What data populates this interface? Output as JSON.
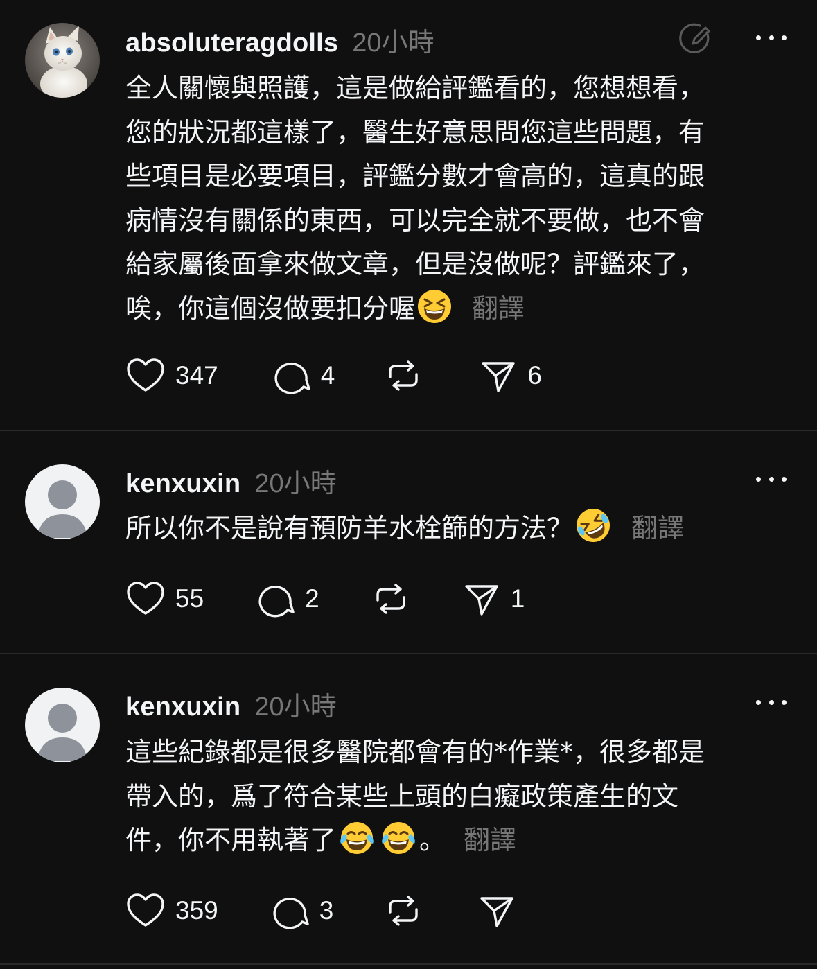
{
  "icons": {
    "like": "heart-icon",
    "reply": "comment-bubble-icon",
    "repost": "repost-icon",
    "share": "send-icon",
    "more": "more-dots-icon",
    "edit": "edit-reply-icon"
  },
  "colors": {
    "background": "#101010",
    "text_primary": "#f3f5f7",
    "text_secondary": "#777777",
    "divider": "#2a2a2a"
  },
  "posts": [
    {
      "username": "absoluteragdolls",
      "time": "20小時",
      "avatar": "cat-avatar",
      "lines": [
        "全人關懷與照護，這是做給評鑑看的，您想想看，",
        "您的狀況都這樣了，醫生好意思問您這些問題，有",
        "些項目是必要項目，評鑑分數才會高的，這真的跟",
        "病情沒有關係的東西，可以完全就不要做，也不會",
        "給家屬後面拿來做文章，但是沒做呢？評鑑來了，",
        "唉，你這個沒做要扣分喔"
      ],
      "emoji": [
        "grinning-squinting-face"
      ],
      "translate": "翻譯",
      "likes": "347",
      "replies": "4",
      "reposts": "",
      "shares": "6"
    },
    {
      "username": "kenxuxin",
      "time": "20小時",
      "avatar": "default-avatar",
      "lines": [
        "所以你不是說有預防羊水栓篩的方法？"
      ],
      "emoji": [
        "rolling-on-the-floor-laughing"
      ],
      "translate": "翻譯",
      "likes": "55",
      "replies": "2",
      "reposts": "",
      "shares": "1"
    },
    {
      "username": "kenxuxin",
      "time": "20小時",
      "avatar": "default-avatar",
      "lines": [
        "這些紀錄都是很多醫院都會有的*作業*，很多都是",
        "帶入的，爲了符合某些上頭的白癡政策產生的文",
        "件，你不用執著了"
      ],
      "emoji": [
        "face-with-tears-of-joy",
        "face-with-tears-of-joy"
      ],
      "tail": "。",
      "translate": "翻譯",
      "likes": "359",
      "replies": "3",
      "reposts": "",
      "shares": ""
    }
  ]
}
